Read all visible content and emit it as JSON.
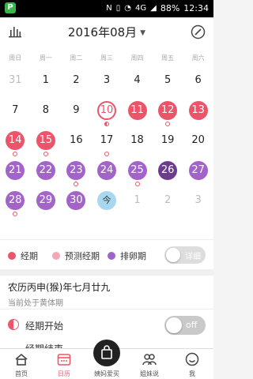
{
  "status_bar": {
    "app_badge": "P",
    "signal_text": "4G",
    "battery": "88%",
    "time": "12:34"
  },
  "header": {
    "month_title": "2016年08月"
  },
  "weekdays": [
    "周日",
    "周一",
    "周二",
    "周三",
    "周四",
    "周五",
    "周六"
  ],
  "calendar": {
    "rows": [
      [
        {
          "d": "31",
          "s": "muted"
        },
        {
          "d": "1"
        },
        {
          "d": "2"
        },
        {
          "d": "3"
        },
        {
          "d": "4"
        },
        {
          "d": "5"
        },
        {
          "d": "6"
        }
      ],
      [
        {
          "d": "7"
        },
        {
          "d": "8"
        },
        {
          "d": "9"
        },
        {
          "d": "10",
          "s": "ringed",
          "m": "half"
        },
        {
          "d": "11",
          "s": "red"
        },
        {
          "d": "12",
          "s": "red",
          "m": "ring"
        },
        {
          "d": "13",
          "s": "red"
        }
      ],
      [
        {
          "d": "14",
          "s": "red",
          "m": "ring"
        },
        {
          "d": "15",
          "s": "red",
          "m": "ring"
        },
        {
          "d": "16"
        },
        {
          "d": "17",
          "m": "ring"
        },
        {
          "d": "18"
        },
        {
          "d": "19"
        },
        {
          "d": "20"
        }
      ],
      [
        {
          "d": "21",
          "s": "purple"
        },
        {
          "d": "22",
          "s": "purple"
        },
        {
          "d": "23",
          "s": "purple",
          "m": "ring"
        },
        {
          "d": "24",
          "s": "purple"
        },
        {
          "d": "25",
          "s": "purple",
          "m": "ring"
        },
        {
          "d": "26",
          "s": "dark"
        },
        {
          "d": "27",
          "s": "purple"
        }
      ],
      [
        {
          "d": "28",
          "s": "purple",
          "m": "ring"
        },
        {
          "d": "29",
          "s": "purple"
        },
        {
          "d": "30",
          "s": "purple"
        },
        {
          "d": "今",
          "s": "today"
        },
        {
          "d": "1",
          "s": "muted"
        },
        {
          "d": "2",
          "s": "muted"
        },
        {
          "d": "3",
          "s": "muted"
        }
      ]
    ]
  },
  "legend": {
    "items": [
      {
        "label": "经期",
        "color": "#ec5469"
      },
      {
        "label": "预测经期",
        "color": "#f4a7b4"
      },
      {
        "label": "排卵期",
        "color": "#a264c8"
      }
    ],
    "detail_toggle_label": "详细",
    "detail_toggle_on": false
  },
  "info": {
    "lunar_date": "农历丙申(猴)年七月廿九",
    "phase": "当前处于黄体期"
  },
  "period_start": {
    "label": "经期开始",
    "toggle_label": "off",
    "on": false
  },
  "period_end": {
    "label": "经期结束"
  },
  "nav": {
    "items": [
      {
        "label": "首页",
        "icon": "home-icon",
        "active": false
      },
      {
        "label": "日历",
        "icon": "calendar-icon",
        "active": true
      },
      {
        "label": "姨妈爱买",
        "icon": "shopping-bag-icon",
        "active": false
      },
      {
        "label": "姐妹说",
        "icon": "community-icon",
        "active": false
      },
      {
        "label": "我",
        "icon": "profile-icon",
        "active": false
      }
    ]
  },
  "colors": {
    "period": "#ec5469",
    "predicted": "#f4a7b4",
    "ovulation": "#a264c8",
    "ovulation_day": "#6e3c8f",
    "today": "#a8d8f0"
  }
}
